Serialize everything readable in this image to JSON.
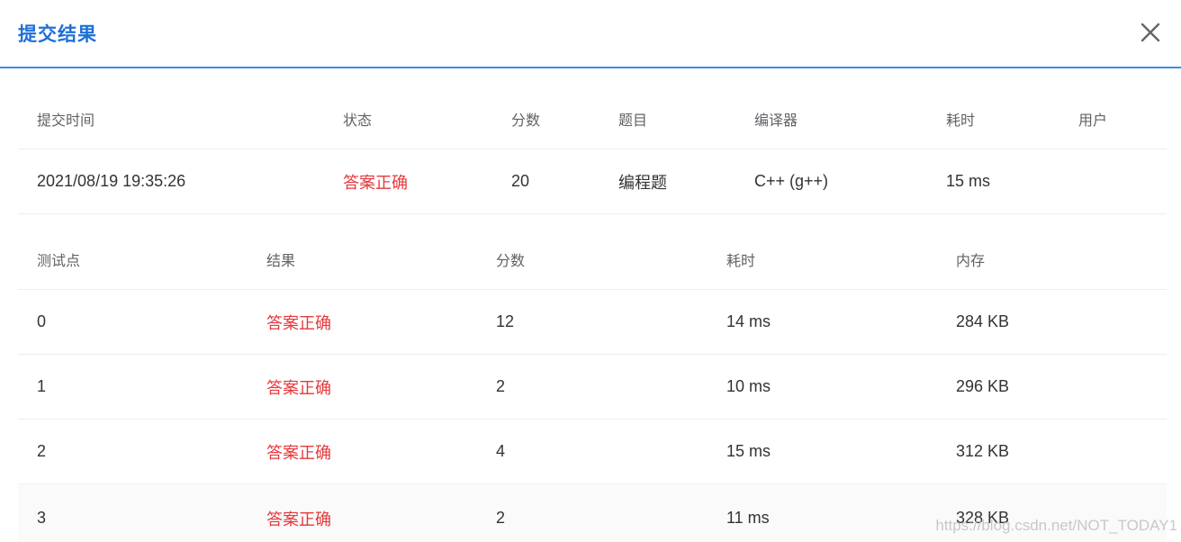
{
  "modal": {
    "title": "提交结果"
  },
  "summary": {
    "headers": [
      "提交时间",
      "状态",
      "分数",
      "题目",
      "编译器",
      "耗时",
      "用户"
    ],
    "row": {
      "time": "2021/08/19 19:35:26",
      "status": "答案正确",
      "score": "20",
      "problem": "编程题",
      "compiler": "C++ (g++)",
      "elapsed": "15 ms",
      "user": ""
    }
  },
  "testcases": {
    "headers": [
      "测试点",
      "结果",
      "分数",
      "耗时",
      "内存"
    ],
    "rows": [
      {
        "id": "0",
        "result": "答案正确",
        "score": "12",
        "time": "14 ms",
        "memory": "284 KB"
      },
      {
        "id": "1",
        "result": "答案正确",
        "score": "2",
        "time": "10 ms",
        "memory": "296 KB"
      },
      {
        "id": "2",
        "result": "答案正确",
        "score": "4",
        "time": "15 ms",
        "memory": "312 KB"
      },
      {
        "id": "3",
        "result": "答案正确",
        "score": "2",
        "time": "11 ms",
        "memory": "328 KB"
      }
    ]
  },
  "watermark": "https://blog.csdn.net/NOT_TODAY1",
  "colors": {
    "accent": "#1f6fd6",
    "header_line": "#3a8ee6",
    "success_text": "#e5383b"
  },
  "icons": {
    "close": "close-icon"
  }
}
